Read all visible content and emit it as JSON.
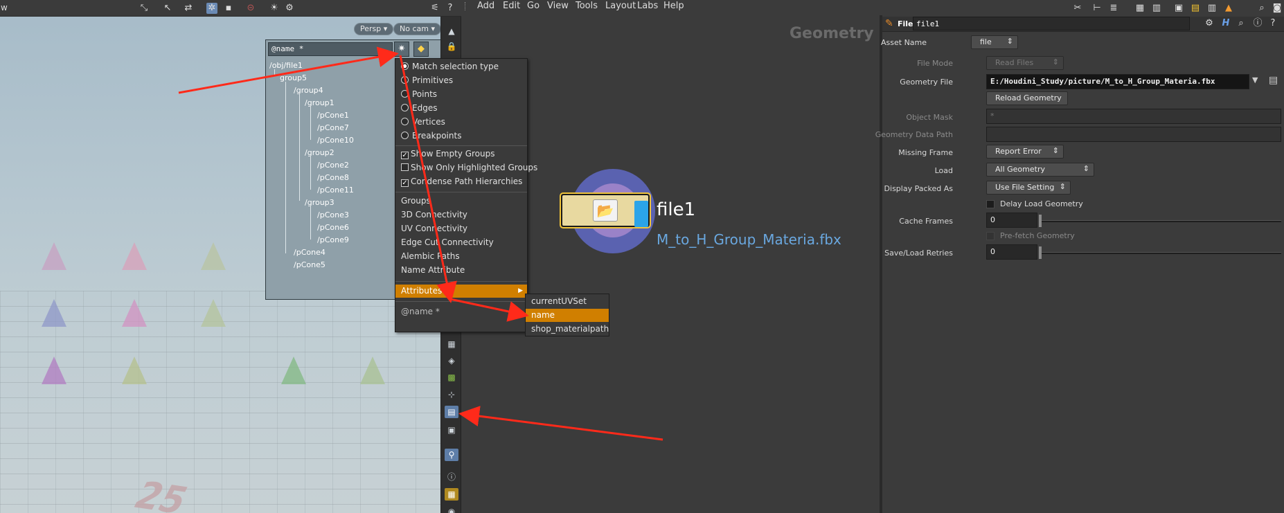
{
  "viewport": {
    "toolbar_left_label": "w",
    "persp_label": "Persp ▾",
    "cam_label": "No cam ▾",
    "group_filter_value": "@name *",
    "ground_number": "25",
    "tree": [
      {
        "label": "/obj/file1"
      },
      {
        "label": "group5"
      },
      {
        "label": "/group4"
      },
      {
        "label": "/group1"
      },
      {
        "label": "/pCone1"
      },
      {
        "label": "/pCone7"
      },
      {
        "label": "/pCone10"
      },
      {
        "label": "/group2"
      },
      {
        "label": "/pCone2"
      },
      {
        "label": "/pCone8"
      },
      {
        "label": "/pCone11"
      },
      {
        "label": "/group3"
      },
      {
        "label": "/pCone3"
      },
      {
        "label": "/pCone6"
      },
      {
        "label": "/pCone9"
      },
      {
        "label": "/pCone4"
      },
      {
        "label": "/pCone5"
      }
    ]
  },
  "context_menu": {
    "radio_items": [
      {
        "label": "Match selection type",
        "selected": true
      },
      {
        "label": "Primitives",
        "selected": false
      },
      {
        "label": "Points",
        "selected": false
      },
      {
        "label": "Edges",
        "selected": false
      },
      {
        "label": "Vertices",
        "selected": false
      },
      {
        "label": "Breakpoints",
        "selected": false
      }
    ],
    "check_items": [
      {
        "label": "Show Empty Groups",
        "checked": true
      },
      {
        "label": "Show Only Highlighted Groups",
        "checked": false
      },
      {
        "label": "Condense Path Hierarchies",
        "checked": true
      }
    ],
    "source_items": [
      "Groups",
      "3D Connectivity",
      "UV Connectivity",
      "Edge Cut Connectivity",
      "Alembic Paths",
      "Name Attribute"
    ],
    "attributes_label": "Attributes",
    "footer_label": "@name *",
    "submenu": [
      "currentUVSet",
      "name",
      "shop_materialpath"
    ],
    "submenu_highlight": "name",
    "highlight_color": "#d07f00"
  },
  "network": {
    "menus": [
      "Add",
      "Edit",
      "Go",
      "View",
      "Tools",
      "Layout",
      "Labs",
      "Help"
    ],
    "context_title": "Geometry",
    "node_name": "file1",
    "node_file": "M_to_H_Group_Materia.fbx"
  },
  "params": {
    "node_type": "File",
    "node_name": "file1",
    "asset_name_label": "Asset Name",
    "asset_name_value": "file",
    "file_mode_label": "File Mode",
    "file_mode_value": "Read Files",
    "geometry_file_label": "Geometry File",
    "geometry_file_value": "E:/Houdini_Study/picture/M_to_H_Group_Materia.fbx",
    "reload_label": "Reload Geometry",
    "object_mask_label": "Object Mask",
    "object_mask_value": "*",
    "geo_data_path_label": "Geometry Data Path",
    "missing_frame_label": "Missing Frame",
    "missing_frame_value": "Report Error",
    "load_label": "Load",
    "load_value": "All Geometry",
    "display_packed_label": "Display Packed As",
    "display_packed_value": "Use File Setting",
    "delay_load_label": "Delay Load Geometry",
    "cache_frames_label": "Cache Frames",
    "cache_frames_value": "0",
    "prefetch_label": "Pre-fetch Geometry",
    "save_load_label": "Save/Load Retries",
    "save_load_value": "0"
  },
  "annotation_color": "#ff2a1a"
}
